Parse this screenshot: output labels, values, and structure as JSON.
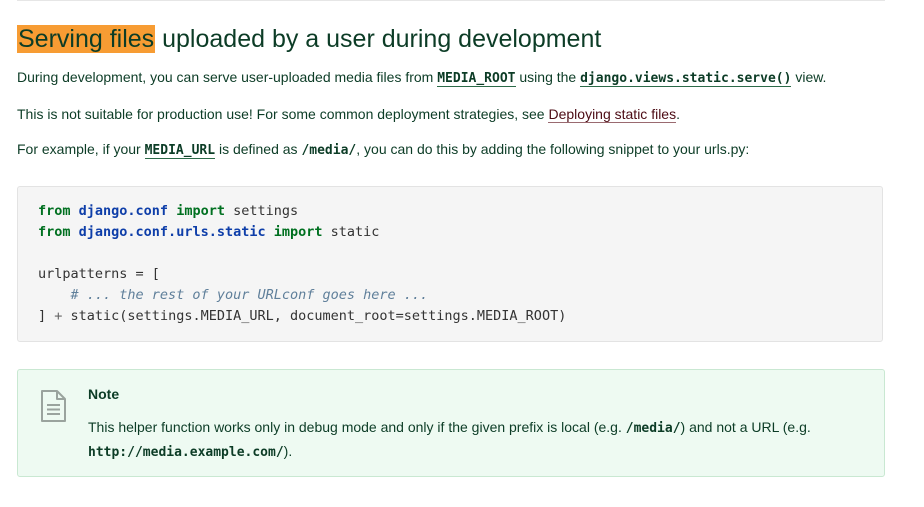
{
  "section": {
    "heading_highlight": "Serving files",
    "heading_rest": " uploaded by a user during development"
  },
  "para1": {
    "t1": "During development, you can serve user-uploaded media files from ",
    "code1": "MEDIA_ROOT",
    "t2": " using the ",
    "code2": "django.views.static.serve()",
    "t3": " view."
  },
  "para2": {
    "t1": "This is not suitable for production use! For some common deployment strategies, see ",
    "link": "Deploying static files",
    "t2": "."
  },
  "para3": {
    "t1": "For example, if your ",
    "code1": "MEDIA_URL",
    "t2": " is defined as ",
    "code2": "/media/",
    "t3": ", you can do this by adding the following snippet to your urls.py:"
  },
  "code": {
    "l1_kw1": "from",
    "l1_mod": "django.conf",
    "l1_kw2": "import",
    "l1_rest": " settings",
    "l2_kw1": "from",
    "l2_mod": "django.conf.urls.static",
    "l2_kw2": "import",
    "l2_rest": " static",
    "l4": "urlpatterns = [",
    "l5_comment": "# ... the rest of your URLconf goes here ...",
    "l6_a": "] ",
    "l6_op": "+",
    "l6_b": " static(settings.MEDIA_URL, document_root=settings.MEDIA_ROOT)"
  },
  "note": {
    "icon": "document-icon",
    "title": "Note",
    "t1": "This helper function works only in debug mode and only if the given prefix is local (e.g. ",
    "code1": "/media/",
    "t2": ") and not a URL (e.g. ",
    "code2": "http://media.example.com/",
    "t3": ")."
  }
}
